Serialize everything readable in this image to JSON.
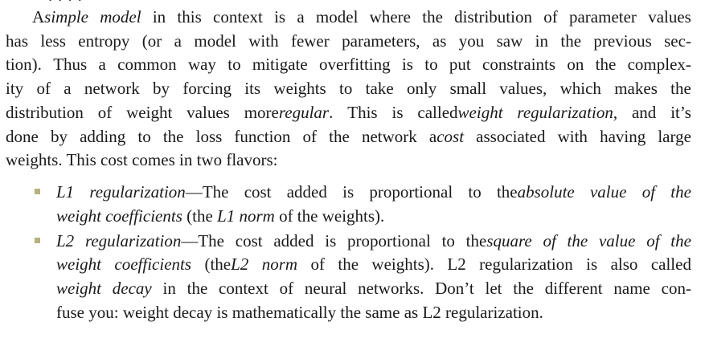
{
  "fragment_top": "·  ·  ·  ·",
  "paragraph": {
    "lines": [
      [
        {
          "t": "A ",
          "i": false
        },
        {
          "t": "simple model",
          "i": true
        },
        {
          "t": " in this context is a model where the distribution of parameter values",
          "i": false
        }
      ],
      [
        {
          "t": "has less entropy (or a model with fewer parameters, as you saw in the previous sec-",
          "i": false
        }
      ],
      [
        {
          "t": "tion). Thus a common way to mitigate overfitting is to put constraints on the complex-",
          "i": false
        }
      ],
      [
        {
          "t": "ity of a network by forcing its weights to take only small values, which makes the",
          "i": false
        }
      ],
      [
        {
          "t": "distribution of weight values more ",
          "i": false
        },
        {
          "t": "regular",
          "i": true
        },
        {
          "t": ". This is called ",
          "i": false
        },
        {
          "t": "weight regularization",
          "i": true
        },
        {
          "t": ", and it’s",
          "i": false
        }
      ],
      [
        {
          "t": "done by adding to the loss function of the network a ",
          "i": false
        },
        {
          "t": "cost",
          "i": true
        },
        {
          "t": " associated with having large",
          "i": false
        }
      ],
      [
        {
          "t": "weights. This cost comes in two flavors:",
          "i": false
        }
      ]
    ]
  },
  "bullets": [
    {
      "lines": [
        [
          {
            "t": "L1 regularization",
            "i": true
          },
          {
            "t": "—The cost added is proportional to the ",
            "i": false
          },
          {
            "t": "absolute value of the",
            "i": true
          }
        ],
        [
          {
            "t": "weight coefficients",
            "i": true
          },
          {
            "t": " (the ",
            "i": false
          },
          {
            "t": "L1 norm",
            "i": true
          },
          {
            "t": " of the weights).",
            "i": false
          }
        ]
      ]
    },
    {
      "lines": [
        [
          {
            "t": "L2 regularization",
            "i": true
          },
          {
            "t": "—The cost added is proportional to the ",
            "i": false
          },
          {
            "t": "square of the value of the",
            "i": true
          }
        ],
        [
          {
            "t": "weight coefficients",
            "i": true
          },
          {
            "t": " (the ",
            "i": false
          },
          {
            "t": "L2 norm",
            "i": true
          },
          {
            "t": " of the weights). L2 regularization is also called",
            "i": false
          }
        ],
        [
          {
            "t": "weight decay",
            "i": true
          },
          {
            "t": " in the context of neural networks. Don’t let the different name con-",
            "i": false
          }
        ],
        [
          {
            "t": "fuse you: weight decay is mathematically the same as L2 regularization.",
            "i": false
          }
        ]
      ]
    }
  ]
}
